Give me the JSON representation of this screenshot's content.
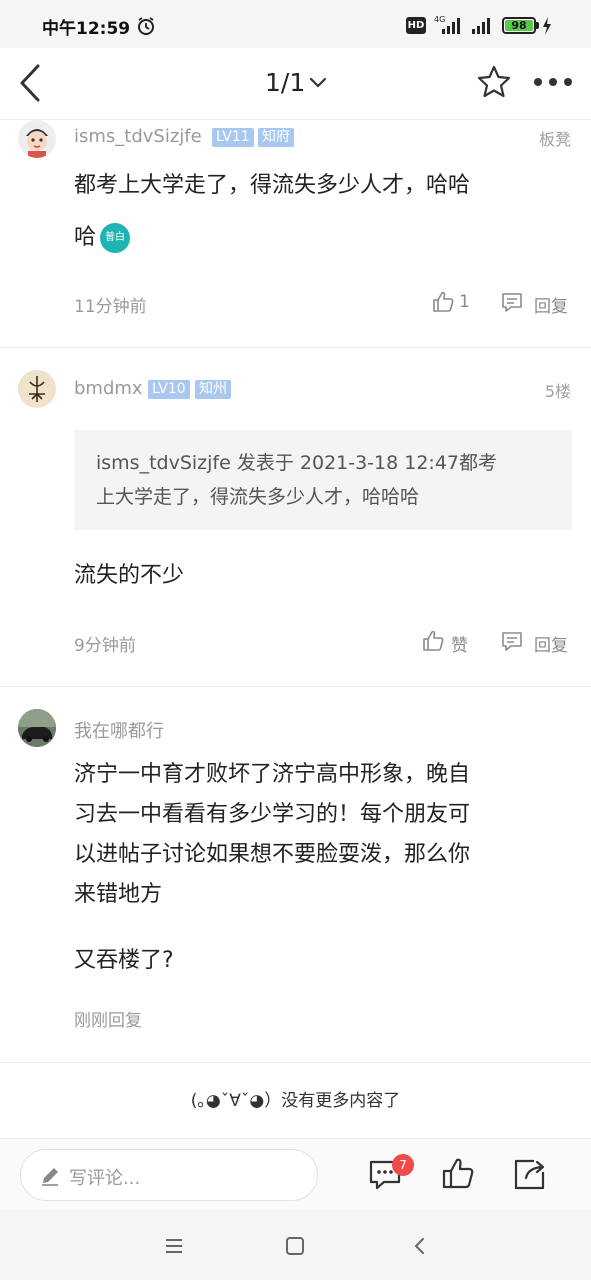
{
  "status_bar": {
    "time": "中午12:59",
    "hd_label": "HD",
    "network_label": "4G",
    "battery_level": "98"
  },
  "nav": {
    "page_indicator": "1/1"
  },
  "comments": [
    {
      "username": "isms_tdvSizjfe",
      "level": "LV11",
      "title": "知府",
      "floor": "板凳",
      "line1": "都考上大学走了，得流失多少人才，哈哈",
      "line2": "哈",
      "emoji_label": "普白",
      "time": "11分钟前",
      "like_count": "1",
      "reply_label": "回复"
    },
    {
      "username": "bmdmx",
      "level": "LV10",
      "title": "知州",
      "floor": "5楼",
      "quote_line1": "isms_tdvSizjfe 发表于 2021-3-18 12:47都考",
      "quote_line2": "上大学走了，得流失多少人才，哈哈哈",
      "content": "流失的不少",
      "time": "9分钟前",
      "like_label": "赞",
      "reply_label": "回复"
    },
    {
      "username": "我在哪都行",
      "line1": "济宁一中育才败坏了济宁高中形象，晚自",
      "line2": "习去一中看看有多少学习的！每个朋友可",
      "line3": "以进帖子讨论如果想不要脸耍泼，那么你",
      "line4": "来错地方",
      "line5": "又吞楼了?",
      "time": "刚刚回复"
    }
  ],
  "end_text": "(｡◕ˇ∀ˇ◕）没有更多内容了",
  "bottom_bar": {
    "placeholder": "写评论...",
    "comment_badge": "7"
  },
  "colors": {
    "tag_bg": "#a8c8ef",
    "badge_red": "#f04a4a",
    "emoji_teal": "#1fb3b3",
    "battery_green": "#5ac84a"
  }
}
